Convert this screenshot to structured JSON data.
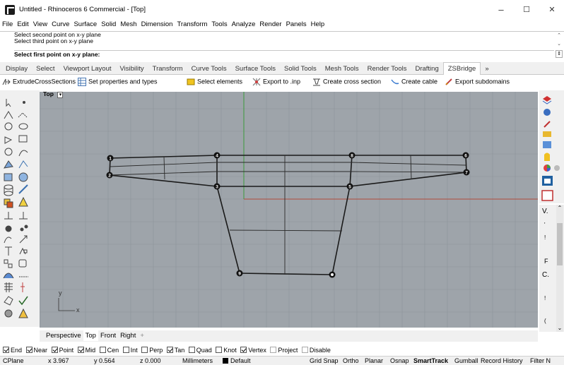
{
  "window": {
    "title": "Untitled - Rhinoceros 6 Commercial - [Top]",
    "minimize": "–",
    "maximize": "☐",
    "close": "✕"
  },
  "menu": [
    "File",
    "Edit",
    "View",
    "Curve",
    "Surface",
    "Solid",
    "Mesh",
    "Dimension",
    "Transform",
    "Tools",
    "Analyze",
    "Render",
    "Panels",
    "Help"
  ],
  "command": {
    "history": [
      "Select second point on x-y plane",
      "Select third point on x-y plane"
    ],
    "prompt": "Select first point on x-y plane:",
    "scroll_up": "⌃",
    "scroll_down": "⌄",
    "spin": "⇕"
  },
  "tabs": [
    "Display",
    "Select",
    "Viewport Layout",
    "Visibility",
    "Transform",
    "Curve Tools",
    "Surface Tools",
    "Solid Tools",
    "Mesh Tools",
    "Render Tools",
    "Drafting",
    "ZSBridge",
    "»"
  ],
  "active_tab": "ZSBridge",
  "toolbar": {
    "extrude": "ExtrudeCrossSections",
    "set_props": "Set properties and types",
    "select_elements": "Select elements",
    "export_inp": "Export to .inp",
    "create_cross": "Create cross section",
    "create_cable": "Create cable",
    "export_sub": "Export subdomains"
  },
  "viewport": {
    "title": "Top",
    "dropdown": "▾",
    "axis_y": "y",
    "axis_x": "x",
    "points": [
      "1",
      "2",
      "3",
      "4",
      "5",
      "6",
      "7",
      "8",
      "9"
    ],
    "colors": {
      "bg": "#9ea4aa",
      "grid": "#8d949a",
      "x_axis": "#b04a3a",
      "y_axis": "#3c9a3c"
    }
  },
  "view_tabs": [
    "Perspective",
    "Top",
    "Front",
    "Right",
    "+"
  ],
  "active_view": "Top",
  "osnaps": [
    {
      "label": "End",
      "on": true
    },
    {
      "label": "Near",
      "on": true
    },
    {
      "label": "Point",
      "on": true
    },
    {
      "label": "Mid",
      "on": true
    },
    {
      "label": "Cen",
      "on": false
    },
    {
      "label": "Int",
      "on": false
    },
    {
      "label": "Perp",
      "on": false
    },
    {
      "label": "Tan",
      "on": true
    },
    {
      "label": "Quad",
      "on": false
    },
    {
      "label": "Knot",
      "on": false
    },
    {
      "label": "Vertex",
      "on": true
    },
    {
      "label": "Project",
      "on": false,
      "disabled": true
    },
    {
      "label": "Disable",
      "on": false,
      "disabled": true
    }
  ],
  "status": {
    "cplane": "CPlane",
    "x": "x 3.967",
    "y": "y 0.564",
    "z": "z 0.000",
    "units": "Millimeters",
    "layer": "Default",
    "grid_snap": "Grid Snap",
    "ortho": "Ortho",
    "planar": "Planar",
    "osnap": "Osnap",
    "smarttrack": "SmartTrack",
    "gumball": "Gumball",
    "record_history": "Record History",
    "filter": "Filter N"
  },
  "right_panel": {
    "letter_v": "V.",
    "letter_f": "F",
    "letter_c": "C.",
    "mark_1": "'",
    "mark_2": "!",
    "mark_3": "(",
    "scroll_up": "⌃",
    "scroll_down": "⌄"
  }
}
